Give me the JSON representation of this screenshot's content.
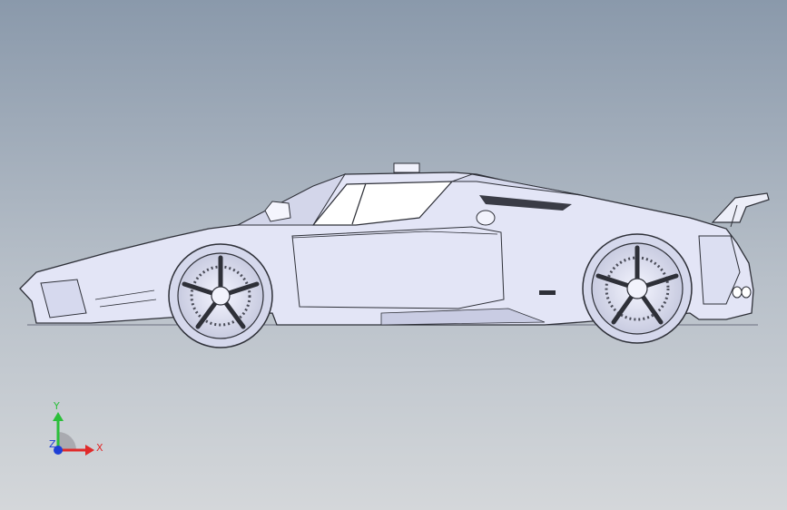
{
  "viewport": {
    "background_top": "#8a99ab",
    "background_bottom": "#d4d7da",
    "model_fill": "#e6e8f7",
    "model_stroke": "#2e3038"
  },
  "triad": {
    "y_label": "Y",
    "x_label": "X",
    "z_label": "Z",
    "y_color": "#2bbf3a",
    "x_color": "#e02a2a",
    "z_color": "#1e3fd6"
  }
}
